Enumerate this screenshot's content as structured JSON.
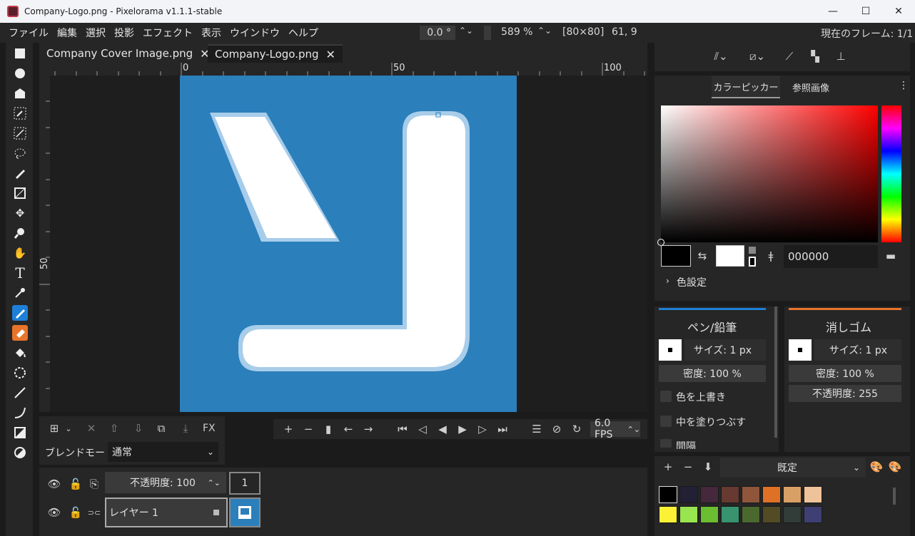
{
  "window": {
    "title": "Company-Logo.png - Pixelorama v1.1.1-stable",
    "minimize": "—",
    "maximize": "☐",
    "close": "✕"
  },
  "menu": {
    "items": [
      "ファイル",
      "編集",
      "選択",
      "投影",
      "エフェクト",
      "表示",
      "ウインドウ",
      "ヘルプ"
    ]
  },
  "topbar": {
    "rotation": "0.0 °",
    "zoom": "589 %",
    "size": "[80×80]",
    "coords": "61, 9",
    "current_frame_label": "現在のフレーム: 1/1"
  },
  "tabs": [
    {
      "label": "Company Cover Image.png",
      "close": "✕"
    },
    {
      "label": "Company-Logo.png",
      "close": "✕"
    }
  ],
  "ruler": {
    "h_labels": [
      "0",
      "50",
      "100"
    ],
    "v_label": "50"
  },
  "right": {
    "panel_tabs": [
      "カラーピッカー",
      "参照画像"
    ],
    "hex_value": "000000",
    "color_settings": "色設定",
    "left_tool": {
      "name": "ペン/鉛筆",
      "size": "サイズ: 1 px",
      "density": "密度: 100 %",
      "overwrite": "色を上書き",
      "fill_inside": "中を塗りつぶす",
      "truncated": "間隔"
    },
    "right_tool": {
      "name": "消しゴム",
      "size": "サイズ: 1 px",
      "density": "密度: 100 %",
      "opacity": "不透明度: 255"
    },
    "palette_name": "既定",
    "palette_colors": [
      [
        "#000000",
        "#222034",
        "#45283c",
        "#663931",
        "#8f563b",
        "#df7126",
        "#d9a066",
        "#eec39a"
      ],
      [
        "#fbf236",
        "#99e550",
        "#6abe30",
        "#37946e",
        "#4b692f",
        "#524b24",
        "#323c39",
        "#3f3f74"
      ]
    ]
  },
  "layers": {
    "blend_label": "ブレンドモード:",
    "blend_value": "通常",
    "fx": "FX",
    "opacity_label": "不透明度: 100",
    "frame_number": "1",
    "layer_name": "レイヤー 1"
  },
  "animation": {
    "fps": "6.0 FPS"
  },
  "colors": {
    "canvas_bg": "#2b7fbb",
    "accent_blue": "#1e7fd8",
    "accent_orange": "#e8742a"
  }
}
